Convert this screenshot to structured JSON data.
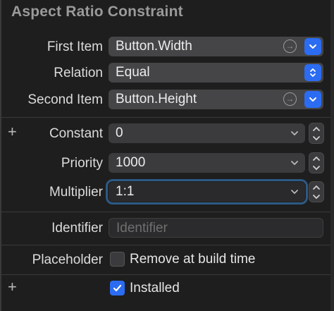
{
  "section": {
    "title": "Aspect Ratio Constraint"
  },
  "first_item": {
    "label": "First Item",
    "value": "Button.Width"
  },
  "relation": {
    "label": "Relation",
    "value": "Equal"
  },
  "second_item": {
    "label": "Second Item",
    "value": "Button.Height"
  },
  "constant": {
    "label": "Constant",
    "value": "0"
  },
  "priority": {
    "label": "Priority",
    "value": "1000"
  },
  "multiplier": {
    "label": "Multiplier",
    "value": "1:1"
  },
  "identifier": {
    "label": "Identifier",
    "placeholder": "Identifier"
  },
  "placeholder": {
    "label": "Placeholder",
    "checkbox_label": "Remove at build time",
    "checked": false
  },
  "installed": {
    "label": "Installed",
    "checked": true
  },
  "icons": {
    "plus": "+",
    "goto": "arrow-right-circle-icon",
    "dropdown": "chevron-down-icon",
    "stepper": "stepper-icon"
  },
  "colors": {
    "accent": "#2b6cf2",
    "focus": "#2c5a86",
    "background": "#1e1e1e"
  }
}
